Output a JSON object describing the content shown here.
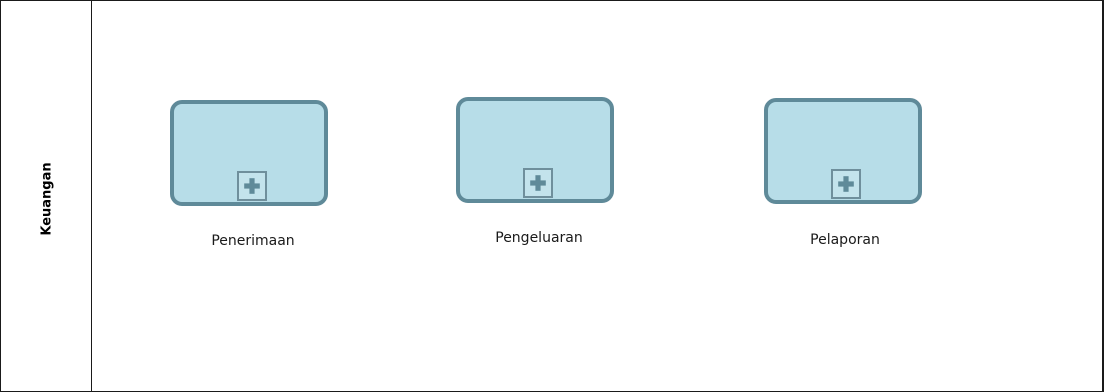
{
  "lane": {
    "label": "Keuangan"
  },
  "subprocesses": [
    {
      "label": "Penerimaan",
      "marker_icon": "plus-icon"
    },
    {
      "label": "Pengeluaran",
      "marker_icon": "plus-icon"
    },
    {
      "label": "Pelaporan",
      "marker_icon": "plus-icon"
    }
  ],
  "colors": {
    "task_fill": "#b7dde8",
    "task_border": "#5f8a99",
    "marker_border": "#6f8f9c",
    "line": "#1a1a1a"
  }
}
